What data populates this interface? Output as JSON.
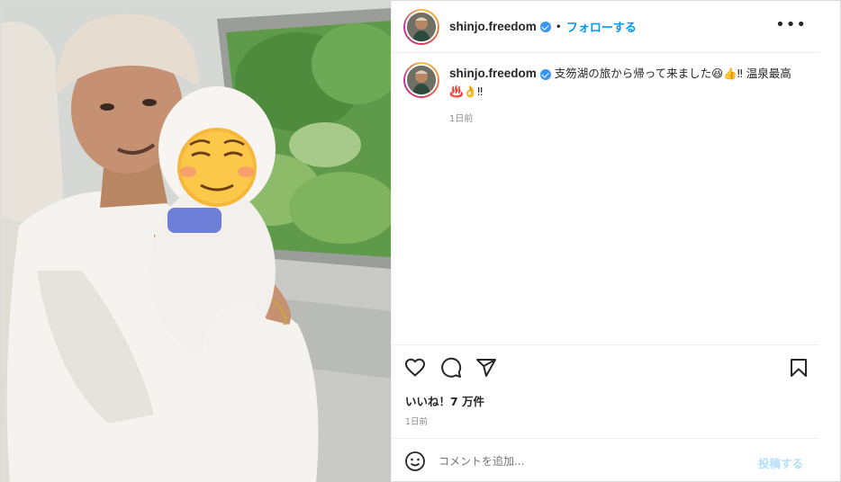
{
  "post": {
    "username": "shinjo.freedom",
    "dot": "•",
    "follow_label": "フォローする",
    "more_label": "•••",
    "caption_text": "支笏湖の旅から帰って来ました😆👍‼︎ 温泉最高♨️👌‼︎",
    "caption_time": "1日前",
    "likes": "いいね！7 万件",
    "post_time": "1日前",
    "comment_placeholder": "コメントを追加...",
    "post_button": "投稿する"
  },
  "icons": {
    "like": "heart-icon",
    "comment": "comment-icon",
    "share": "paper-plane-icon",
    "save": "bookmark-icon",
    "emoji": "smiley-icon",
    "more": "more-dots-icon",
    "verified": "verified-badge-icon"
  },
  "colors": {
    "link_blue": "#0095f6",
    "verified_blue": "#3897f0",
    "muted": "#8e8e8e",
    "post_disabled": "#b2dffc"
  }
}
